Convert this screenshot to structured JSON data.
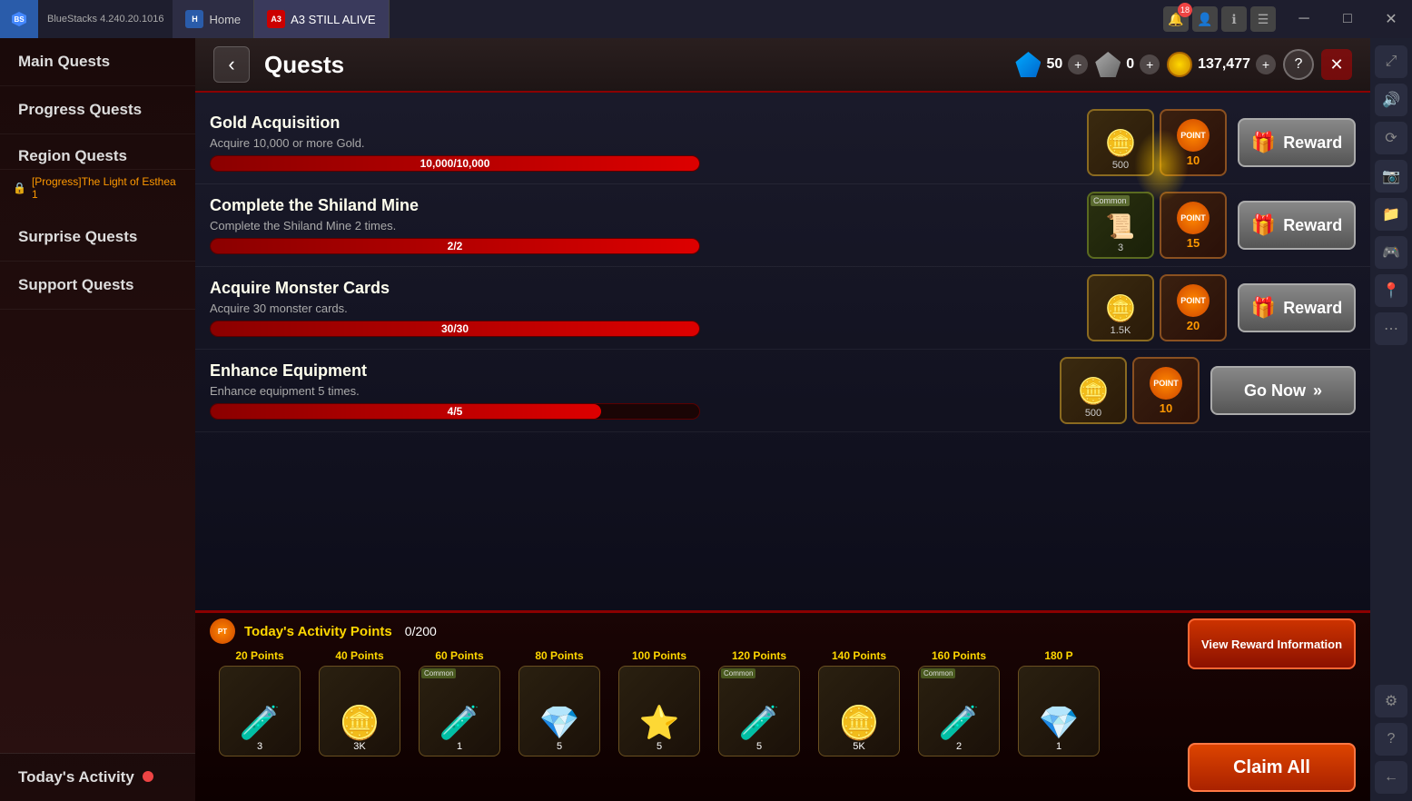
{
  "titlebar": {
    "app_name": "BlueStacks",
    "app_version": "4.240.20.1016",
    "home_tab": "Home",
    "game_tab": "A3  STILL ALIVE",
    "notification_count": "18"
  },
  "header": {
    "back_label": "‹",
    "title": "Quests",
    "diamond_count": "50",
    "diamond_add": "+",
    "gray_diamond_count": "0",
    "gray_diamond_add": "+",
    "gold_count": "137,477",
    "gold_add": "+",
    "help_label": "?",
    "close_label": "✕"
  },
  "sidebar": {
    "items": [
      {
        "label": "Main Quests"
      },
      {
        "label": "Progress Quests"
      },
      {
        "label": "Region Quests"
      },
      {
        "label": "Surprise Quests"
      },
      {
        "label": "Support Quests"
      }
    ],
    "region_sub": "[Progress]The Light of Esthea 1",
    "today_label": "Today's Activity"
  },
  "quests": [
    {
      "name": "Gold Acquisition",
      "desc": "Acquire 10,000 or more Gold.",
      "progress_text": "10,000/10,000",
      "progress_pct": 100,
      "reward_type": "gold",
      "reward_amount": "500",
      "point_amount": "10",
      "btn_label": "Reward"
    },
    {
      "name": "Complete the Shiland Mine",
      "desc": "Complete the Shiland Mine 2 times.",
      "progress_text": "2/2",
      "progress_pct": 100,
      "reward_type": "scroll",
      "reward_amount": "3",
      "point_amount": "15",
      "btn_label": "Reward",
      "common_badge": "Common"
    },
    {
      "name": "Acquire Monster Cards",
      "desc": "Acquire 30 monster cards.",
      "progress_text": "30/30",
      "progress_pct": 100,
      "reward_type": "gold",
      "reward_amount": "1.5K",
      "point_amount": "20",
      "btn_label": "Reward"
    },
    {
      "name": "Enhance Equipment",
      "desc": "Enhance equipment 5 times.",
      "progress_text": "4/5",
      "progress_pct": 80,
      "reward_type": "gold",
      "reward_amount": "500",
      "point_amount": "10",
      "btn_label": "Go Now"
    }
  ],
  "activity": {
    "title": "Today's Activity Points",
    "progress": "0/200",
    "milestones": [
      {
        "label": "20 Points",
        "icon": "🧪",
        "count": "3",
        "common": false
      },
      {
        "label": "40 Points",
        "icon": "🪙",
        "count": "3K",
        "common": false
      },
      {
        "label": "60 Points",
        "icon": "🧪",
        "count": "1",
        "common": true
      },
      {
        "label": "80 Points",
        "icon": "💎",
        "count": "5",
        "common": false
      },
      {
        "label": "100 Points",
        "icon": "⭐",
        "count": "5",
        "common": false
      },
      {
        "label": "120 Points",
        "icon": "🧪",
        "count": "5",
        "common": true
      },
      {
        "label": "140 Points",
        "icon": "🪙",
        "count": "5K",
        "common": false
      },
      {
        "label": "160 Points",
        "icon": "🧪",
        "count": "2",
        "common": true
      },
      {
        "label": "180 P",
        "icon": "💎",
        "count": "1",
        "common": false
      }
    ],
    "view_reward_btn": "View Reward Information",
    "claim_all_btn": "Claim All"
  }
}
